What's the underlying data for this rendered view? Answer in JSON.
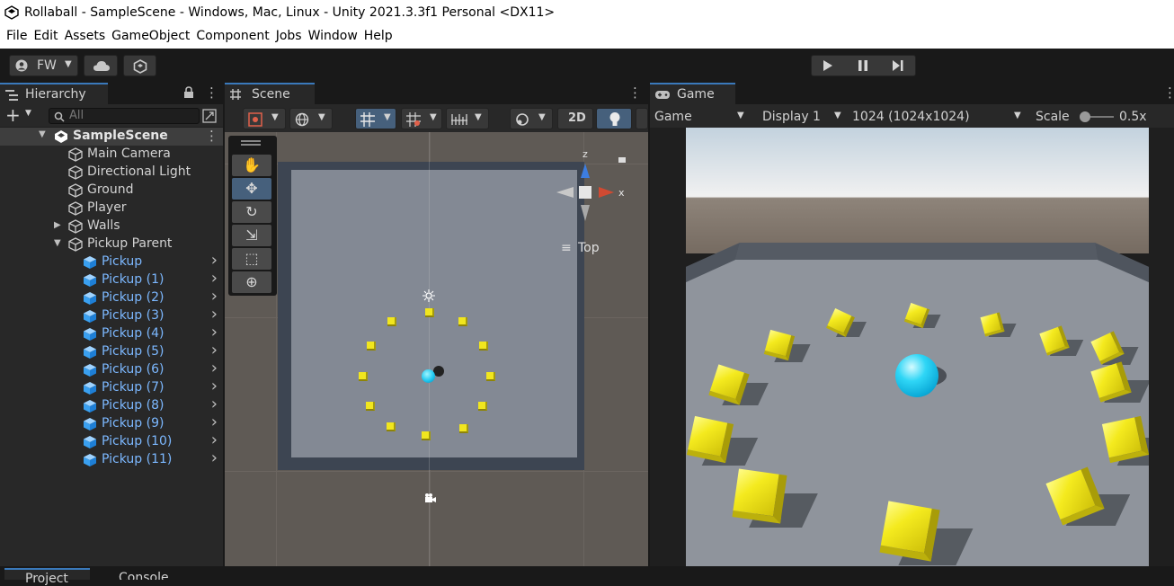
{
  "window": {
    "title": "Rollaball - SampleScene - Windows, Mac, Linux - Unity 2021.3.3f1 Personal <DX11>"
  },
  "menu": [
    "File",
    "Edit",
    "Assets",
    "GameObject",
    "Component",
    "Jobs",
    "Window",
    "Help"
  ],
  "toolbar": {
    "account_label": "FW"
  },
  "hierarchy": {
    "tab": "Hierarchy",
    "search_placeholder": "All",
    "scene": "SampleScene",
    "items": [
      {
        "label": "Main Camera",
        "type": "object"
      },
      {
        "label": "Directional Light",
        "type": "object"
      },
      {
        "label": "Ground",
        "type": "object"
      },
      {
        "label": "Player",
        "type": "object"
      },
      {
        "label": "Walls",
        "type": "object"
      },
      {
        "label": "Pickup Parent",
        "type": "object"
      },
      {
        "label": "Pickup",
        "type": "prefab"
      },
      {
        "label": "Pickup (1)",
        "type": "prefab"
      },
      {
        "label": "Pickup (2)",
        "type": "prefab"
      },
      {
        "label": "Pickup (3)",
        "type": "prefab"
      },
      {
        "label": "Pickup (4)",
        "type": "prefab"
      },
      {
        "label": "Pickup (5)",
        "type": "prefab"
      },
      {
        "label": "Pickup (6)",
        "type": "prefab"
      },
      {
        "label": "Pickup (7)",
        "type": "prefab"
      },
      {
        "label": "Pickup (8)",
        "type": "prefab"
      },
      {
        "label": "Pickup (9)",
        "type": "prefab"
      },
      {
        "label": "Pickup (10)",
        "type": "prefab"
      },
      {
        "label": "Pickup (11)",
        "type": "prefab"
      }
    ]
  },
  "scene": {
    "tab": "Scene",
    "mode_2d": "2D",
    "gizmo": {
      "z": "z",
      "x": "x",
      "view": "Top"
    }
  },
  "game": {
    "tab": "Game",
    "view": "Game",
    "display": "Display 1",
    "resolution": "1024 (1024x1024)",
    "scale_label": "Scale",
    "scale_value": "0.5x"
  },
  "bottom": {
    "tabs": [
      "Project",
      "Console"
    ]
  },
  "colors": {
    "accent": "#3a79bb",
    "pickup": "#f1e61e",
    "player": "#1ec8f0",
    "prefab_text": "#7cb8ff"
  }
}
